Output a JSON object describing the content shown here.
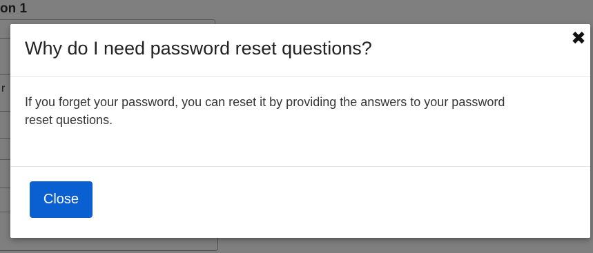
{
  "background": {
    "section_label": "on 1",
    "glyphs": [
      "r",
      "o"
    ]
  },
  "modal": {
    "title": "Why do I need password reset questions?",
    "close_icon_glyph": "✖",
    "body_text": "If you forget your password, you can reset it by providing the answers to your password reset questions.",
    "close_button_label": "Close"
  },
  "colors": {
    "primary_button": "#0a5fd1",
    "overlay": "rgba(0,0,0,0.5)"
  },
  "icons": {
    "close": "close-icon"
  }
}
